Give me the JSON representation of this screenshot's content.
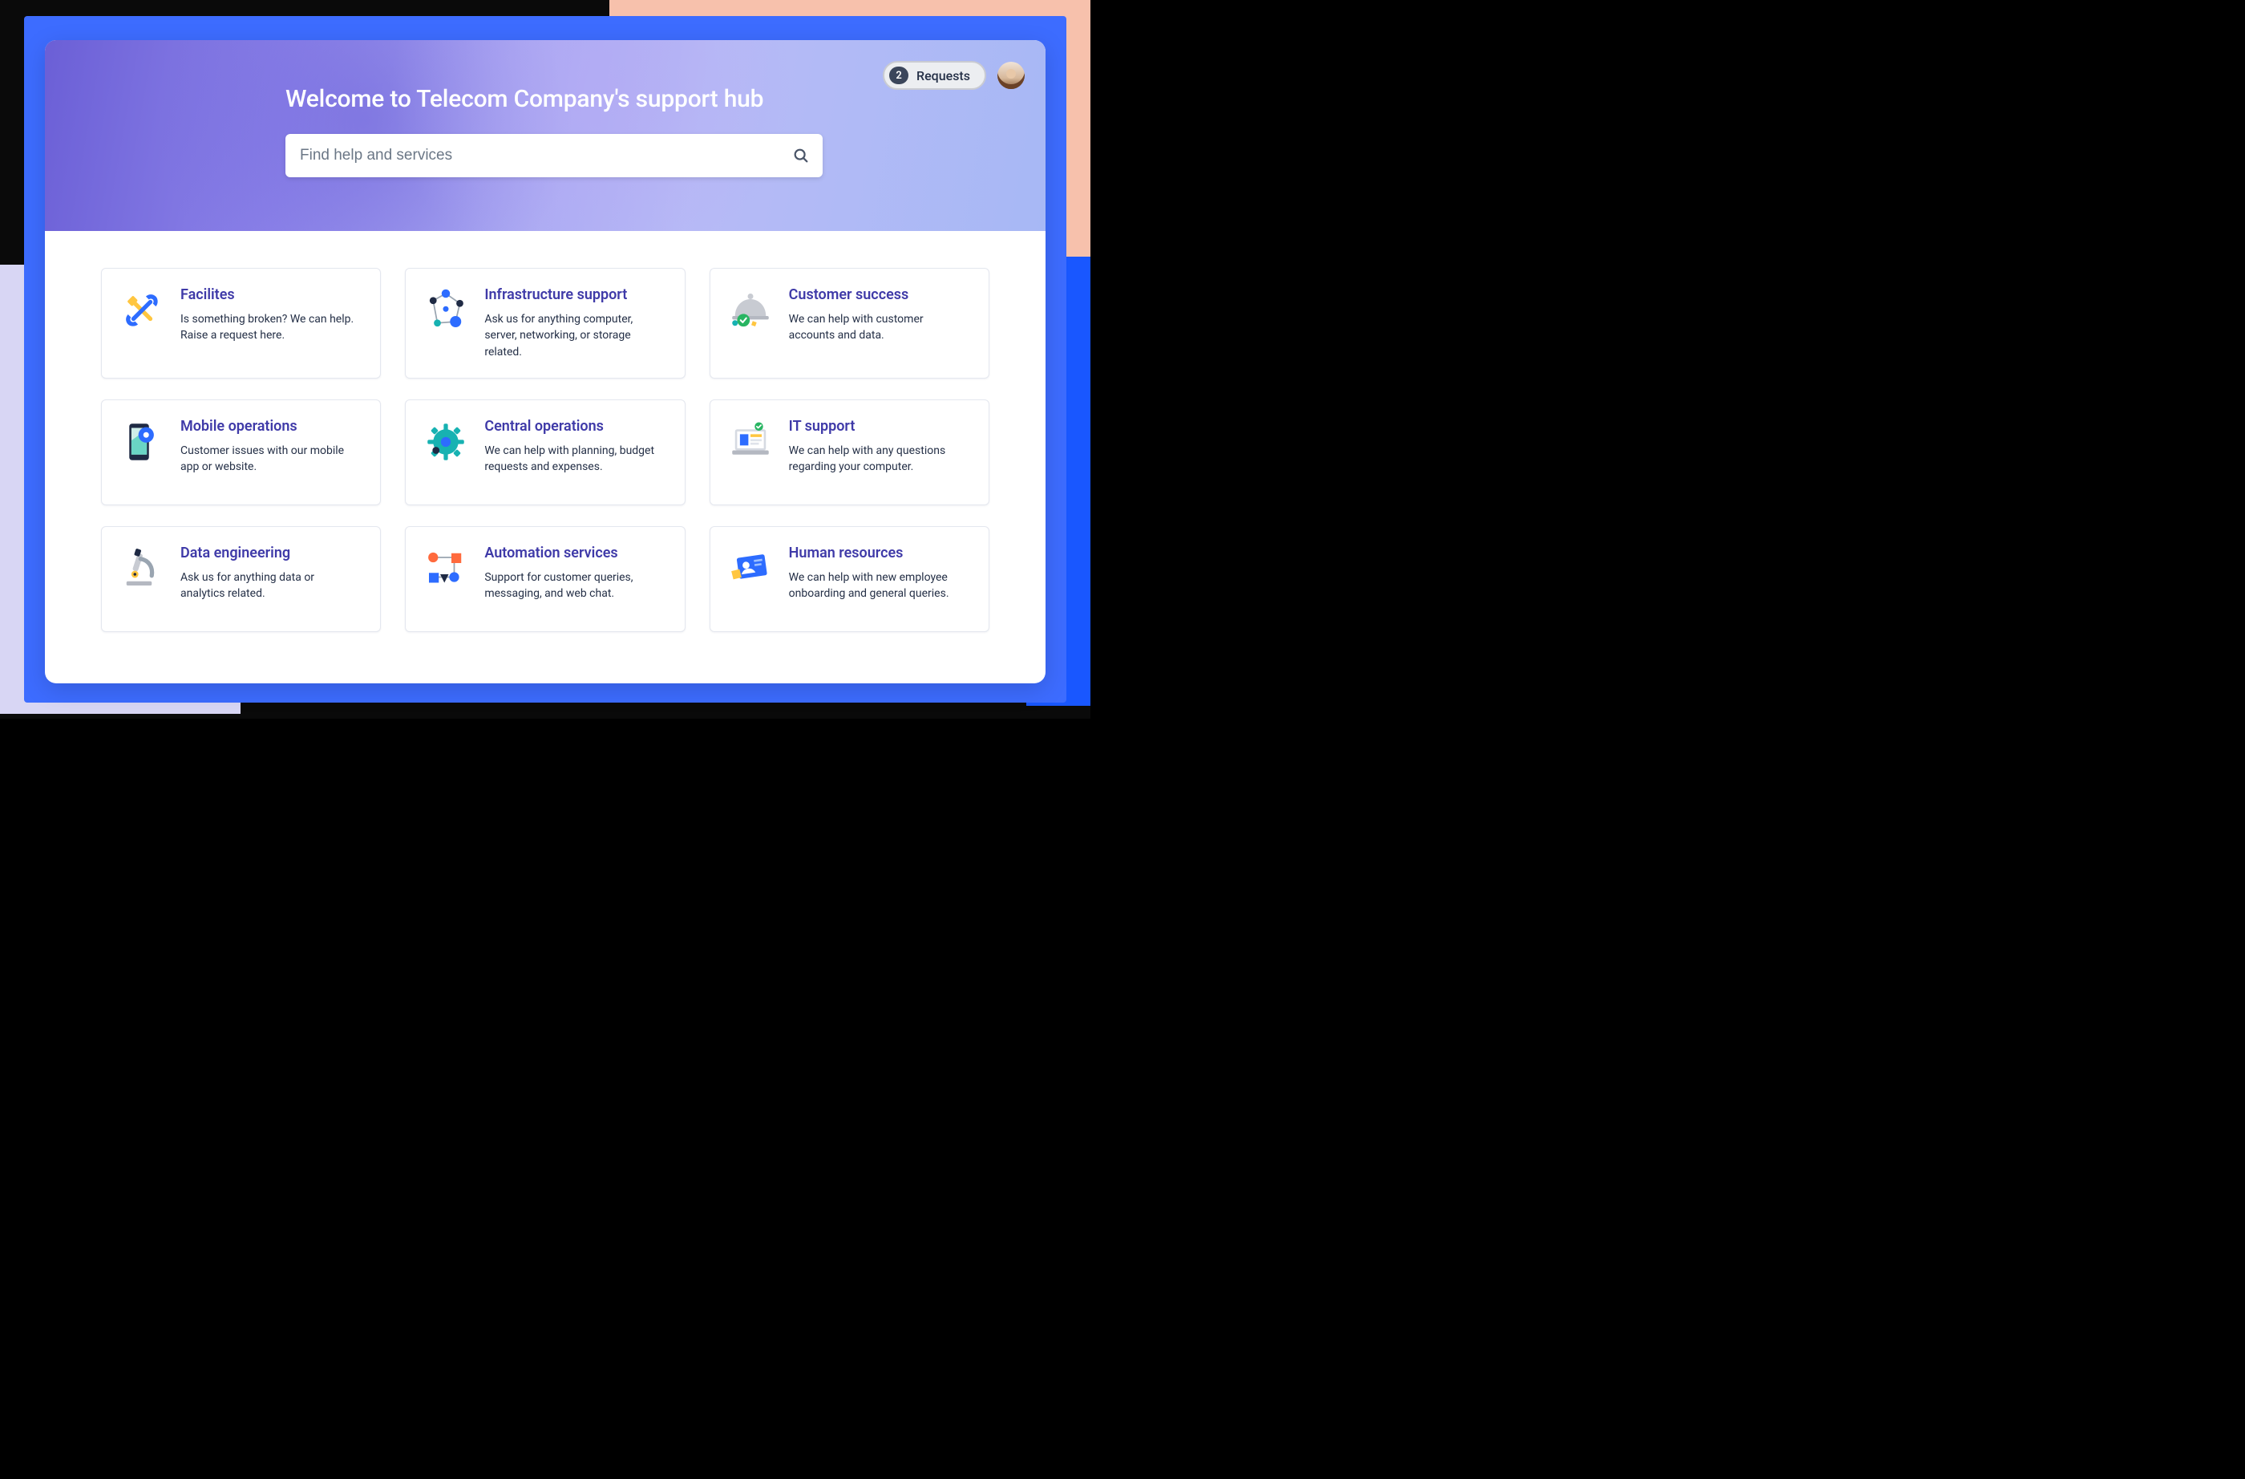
{
  "hero": {
    "title": "Welcome to Telecom Company's support hub",
    "search_placeholder": "Find help and services"
  },
  "header": {
    "requests_count": "2",
    "requests_label": "Requests"
  },
  "cards": [
    {
      "id": "facilities",
      "title": "Facilites",
      "desc": "Is something broken? We can help. Raise a request here.",
      "icon": "tools-icon"
    },
    {
      "id": "infrastructure",
      "title": "Infrastructure support",
      "desc": "Ask us for anything computer, server, networking, or storage related.",
      "icon": "network-icon"
    },
    {
      "id": "customer-success",
      "title": "Customer success",
      "desc": "We can help with customer accounts and data.",
      "icon": "cloche-icon"
    },
    {
      "id": "mobile-ops",
      "title": "Mobile operations",
      "desc": "Customer issues with our mobile app or website.",
      "icon": "phone-map-icon"
    },
    {
      "id": "central-ops",
      "title": "Central operations",
      "desc": "We can help with planning, budget requests and expenses.",
      "icon": "gear-icon"
    },
    {
      "id": "it-support",
      "title": "IT support",
      "desc": "We can help with any questions regarding your computer.",
      "icon": "laptop-icon"
    },
    {
      "id": "data-eng",
      "title": "Data engineering",
      "desc": "Ask us for anything data or analytics related.",
      "icon": "microscope-icon"
    },
    {
      "id": "automation",
      "title": "Automation services",
      "desc": "Support for customer queries, messaging, and web chat.",
      "icon": "flow-icon"
    },
    {
      "id": "hr",
      "title": "Human resources",
      "desc": "We can help with new employee onboarding and general queries.",
      "icon": "id-card-icon"
    }
  ],
  "colors": {
    "accent": "#3f3aa8",
    "blue": "#2d6cff",
    "teal": "#17b2b2",
    "green": "#28b562",
    "orange": "#ff9d3b",
    "orangered": "#ff6a3d",
    "yellow": "#ffc640"
  }
}
